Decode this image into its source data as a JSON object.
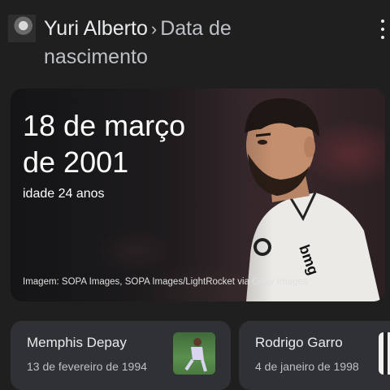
{
  "header": {
    "entity": "Yuri Alberto",
    "separator": "›",
    "attribute_line1": "Data de",
    "attribute_line2": "nascimento",
    "menu_icon": "more-vert-icon"
  },
  "hero": {
    "date_line1": "18 de março",
    "date_line2": "de 2001",
    "age": "idade 24 anos",
    "credit": "Imagem: SOPA Images, SOPA Images/LightRocket via Getty Images",
    "shirt_sponsor": "bmg"
  },
  "related": [
    {
      "name": "Memphis Depay",
      "date": "13 de fevereiro de 1994"
    },
    {
      "name": "Rodrigo Garro",
      "date": "4 de janeiro de 1998"
    }
  ],
  "colors": {
    "background": "#1f1f1f",
    "card": "#303134",
    "text": "#e8eaed",
    "muted": "#bdc1c6"
  }
}
